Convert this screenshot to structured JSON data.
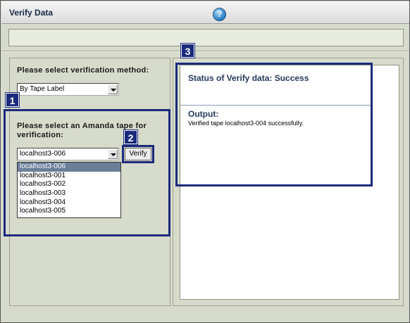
{
  "window": {
    "title": "Verify Data",
    "help_icon": "question-mark-icon",
    "help_glyph": "?"
  },
  "left_panel": {
    "method_label": "Please select verification method:",
    "method_value": "By Tape Label",
    "tape_label": "Please select an Amanda tape for verification:",
    "tape_value": "localhost3-006",
    "tape_options": [
      "localhost3-006",
      "localhost3-001",
      "localhost3-002",
      "localhost3-003",
      "localhost3-004",
      "localhost3-005"
    ],
    "verify_label": "Verify"
  },
  "right_panel": {
    "status": "Status of Verify data: Success",
    "output_label": "Output:",
    "output_text": "Verified tape localhost3-004 successfully."
  },
  "callouts": [
    "1",
    "2",
    "3"
  ],
  "colors": {
    "callout": "#1b2a7a",
    "panel_bg": "#d7dbcc",
    "selected_option": "#6b7e99",
    "status_text": "#243a5c"
  }
}
